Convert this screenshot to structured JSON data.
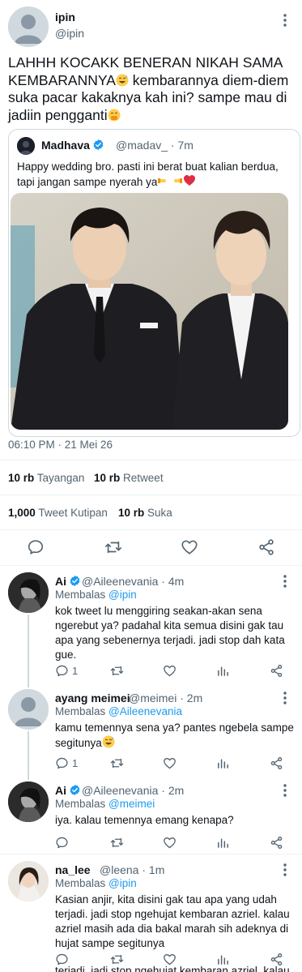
{
  "tweet": {
    "author_name": "ipin",
    "author_handle": "@ipin",
    "text": "LAHHH KOCAKK BENERAN NIKAH SAMA KEMBARANNYA",
    "text_after_emoji_1": " kembarannya diem-diem suka pacar kakaknya kah ini? sampe mau di jadiin pengganti",
    "emoji_1": "grinning-sweat-emoji",
    "emoji_2": "hand-over-mouth-emoji",
    "timestamp": "06:10 PM · 21 Mei 26",
    "views_count": "10 rb",
    "views_label": "Tayangan",
    "retweets_count": "10 rb",
    "retweets_label": "Retweet",
    "quotes_count": "1,000",
    "quotes_label": "Tweet Kutipan",
    "likes_count": "10 rb",
    "likes_label": "Suka"
  },
  "quoted_tweet": {
    "author_name": "Madhava",
    "author_handle": "@madav_",
    "time": "· 7m",
    "text": "Happy wedding bro. pasti ini berat buat kalian berdua, tapi jangan sampe nyerah ya",
    "emojis": [
      "handshake-left-emoji",
      "handshake-right-emoji",
      "red-heart-emoji"
    ]
  },
  "replies": [
    {
      "name": "Ai",
      "handle": "@Aileenevania",
      "time": "· 4m",
      "replying_label": "Membalas",
      "replying_to": "@ipin",
      "text": "kok tweet lu menggiring seakan-akan sena ngerebut ya? padahal kita semua disini gak tau apa yang sebenernya terjadi. jadi stop dah kata gue.",
      "reply_count": "1",
      "verified": true
    },
    {
      "name": "ayang meimei",
      "handle": "@meimei",
      "time": "· 2m",
      "replying_label": "Membalas",
      "replying_to": "@Aileenevania",
      "text": "kamu temennya sena ya? pantes ngebela sampe segitunya",
      "reply_count": "1",
      "verified": false
    },
    {
      "name": "Ai",
      "handle": "@Aileenevania",
      "time": "· 2m",
      "replying_label": "Membalas",
      "replying_to": "@meimei",
      "text": "iya. kalau temennya emang kenapa?",
      "reply_count": "",
      "verified": true
    },
    {
      "name": "na_lee",
      "handle": "@leena",
      "time": "· 1m",
      "replying_label": "Membalas",
      "replying_to": "@ipin",
      "text": "Kasian anjir, kita disini gak tau apa yang udah terjadi. jadi stop ngehujat kembaran azriel. kalau azriel masih ada dia bakal marah sih adeknya di hujat sampe segitunya",
      "reply_count": "",
      "verified": false
    }
  ],
  "cut_off_text": "terjadi. jadi stop ngehujat kembaran azriel. kalau",
  "colors": {
    "link_blue": "#1d9bf0",
    "text_primary": "#0f1419",
    "text_secondary": "#536471",
    "divider": "#eff3f4"
  }
}
